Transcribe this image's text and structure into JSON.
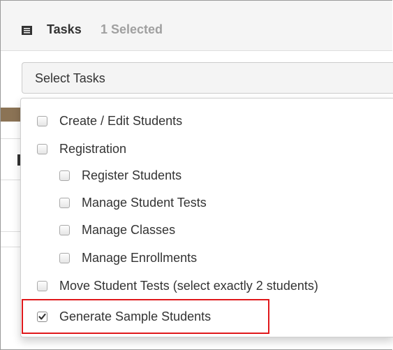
{
  "header": {
    "icon": "list-icon",
    "title": "Tasks",
    "selected_count": "1 Selected"
  },
  "select": {
    "label": "Select Tasks",
    "options": [
      {
        "label": "Create / Edit Students",
        "checked": false
      },
      {
        "label": "Registration",
        "checked": false
      },
      {
        "label": "Register Students",
        "checked": false
      },
      {
        "label": "Manage Student Tests",
        "checked": false
      },
      {
        "label": "Manage Classes",
        "checked": false
      },
      {
        "label": "Manage Enrollments",
        "checked": false
      },
      {
        "label": "Move Student Tests (select exactly 2 students)",
        "checked": false
      },
      {
        "label": "Generate Sample Students",
        "checked": true
      }
    ]
  },
  "colors": {
    "highlight": "#e0181b",
    "header_bg": "#f5f5f5",
    "text": "#333333",
    "muted": "#a0a0a0"
  }
}
